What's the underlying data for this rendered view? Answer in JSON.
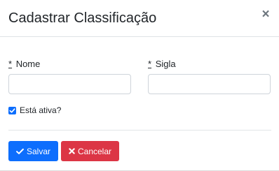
{
  "modal": {
    "title": "Cadastrar Classificação",
    "close_icon": "close-icon",
    "close_glyph": "×"
  },
  "form": {
    "required_marker": "*",
    "nome": {
      "label": "Nome",
      "value": "",
      "placeholder": ""
    },
    "sigla": {
      "label": "Sigla",
      "value": "",
      "placeholder": ""
    },
    "ativa": {
      "label": "Está ativa?",
      "checked": true
    }
  },
  "actions": {
    "save_label": "Salvar",
    "save_icon": "check-icon",
    "cancel_label": "Cancelar",
    "cancel_icon": "times-icon"
  },
  "colors": {
    "primary": "#0d6efd",
    "danger": "#dc3545",
    "text": "#212529",
    "border": "#ced4da"
  }
}
